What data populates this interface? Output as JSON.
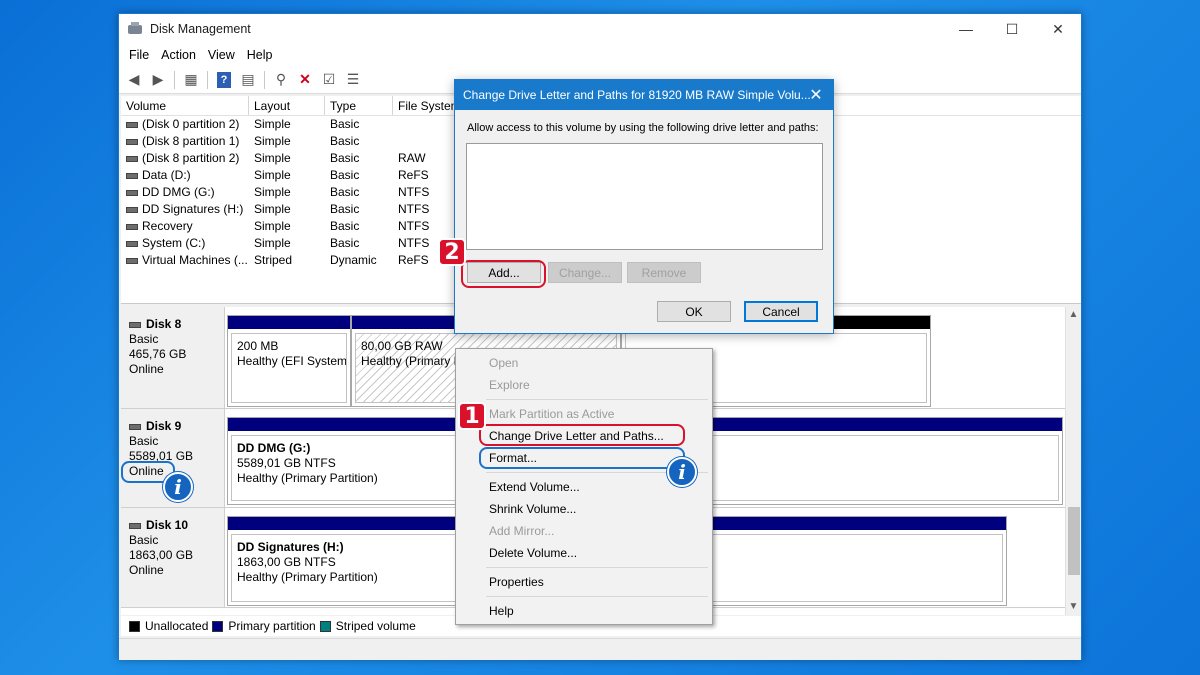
{
  "window": {
    "title": "Disk Management",
    "controls": {
      "minimize": "—",
      "maximize": "☐",
      "close": "✕"
    }
  },
  "menu": [
    "File",
    "Action",
    "View",
    "Help"
  ],
  "volume_table": {
    "columns": [
      "Volume",
      "Layout",
      "Type",
      "File System"
    ],
    "rows": [
      {
        "volume": "(Disk 0 partition 2)",
        "layout": "Simple",
        "type": "Basic",
        "fs": ""
      },
      {
        "volume": "(Disk 8 partition 1)",
        "layout": "Simple",
        "type": "Basic",
        "fs": ""
      },
      {
        "volume": "(Disk 8 partition 2)",
        "layout": "Simple",
        "type": "Basic",
        "fs": "RAW"
      },
      {
        "volume": "Data (D:)",
        "layout": "Simple",
        "type": "Basic",
        "fs": "ReFS"
      },
      {
        "volume": "DD DMG (G:)",
        "layout": "Simple",
        "type": "Basic",
        "fs": "NTFS"
      },
      {
        "volume": "DD Signatures (H:)",
        "layout": "Simple",
        "type": "Basic",
        "fs": "NTFS"
      },
      {
        "volume": "Recovery",
        "layout": "Simple",
        "type": "Basic",
        "fs": "NTFS"
      },
      {
        "volume": "System (C:)",
        "layout": "Simple",
        "type": "Basic",
        "fs": "NTFS"
      },
      {
        "volume": "Virtual Machines (...",
        "layout": "Striped",
        "type": "Dynamic",
        "fs": "ReFS"
      }
    ]
  },
  "disks": [
    {
      "name": "Disk 8",
      "type": "Basic",
      "size": "465,76 GB",
      "status": "Online",
      "partitions": [
        {
          "line1": "200 MB",
          "line2": "Healthy (EFI System P"
        },
        {
          "line1": "80,00 GB RAW",
          "line2": "Healthy (Primary P"
        }
      ]
    },
    {
      "name": "Disk 9",
      "type": "Basic",
      "size": "5589,01 GB",
      "status": "Online",
      "partitions": [
        {
          "title": "DD DMG  (G:)",
          "line1": "5589,01 GB NTFS",
          "line2": "Healthy (Primary Partition)"
        }
      ]
    },
    {
      "name": "Disk 10",
      "type": "Basic",
      "size": "1863,00 GB",
      "status": "Online",
      "partitions": [
        {
          "title": "DD Signatures  (H:)",
          "line1": "1863,00 GB NTFS",
          "line2": "Healthy (Primary Partition)"
        }
      ]
    }
  ],
  "legend": [
    {
      "label": "Unallocated",
      "color": "#000000"
    },
    {
      "label": "Primary partition",
      "color": "#00007f"
    },
    {
      "label": "Striped volume",
      "color": "#008080"
    }
  ],
  "dialog": {
    "title": "Change Drive Letter and Paths for 81920 MB RAW Simple Volu...",
    "instruction": "Allow access to this volume by using the following drive letter and paths:",
    "add": "Add...",
    "change": "Change...",
    "remove": "Remove",
    "ok": "OK",
    "cancel": "Cancel"
  },
  "context_menu": {
    "items": [
      {
        "label": "Open",
        "enabled": false
      },
      {
        "label": "Explore",
        "enabled": false
      },
      {
        "label": "Mark Partition as Active",
        "enabled": false
      },
      {
        "label": "Change Drive Letter and Paths...",
        "enabled": true
      },
      {
        "label": "Format...",
        "enabled": true
      },
      {
        "label": "Extend Volume...",
        "enabled": true
      },
      {
        "label": "Shrink Volume...",
        "enabled": true
      },
      {
        "label": "Add Mirror...",
        "enabled": false
      },
      {
        "label": "Delete Volume...",
        "enabled": true
      },
      {
        "label": "Properties",
        "enabled": true
      },
      {
        "label": "Help",
        "enabled": true
      }
    ]
  },
  "annotations": {
    "step1": "1",
    "step2": "2",
    "info": "i",
    "highlight_red": "#d9112b",
    "highlight_blue": "#1a73c9"
  }
}
